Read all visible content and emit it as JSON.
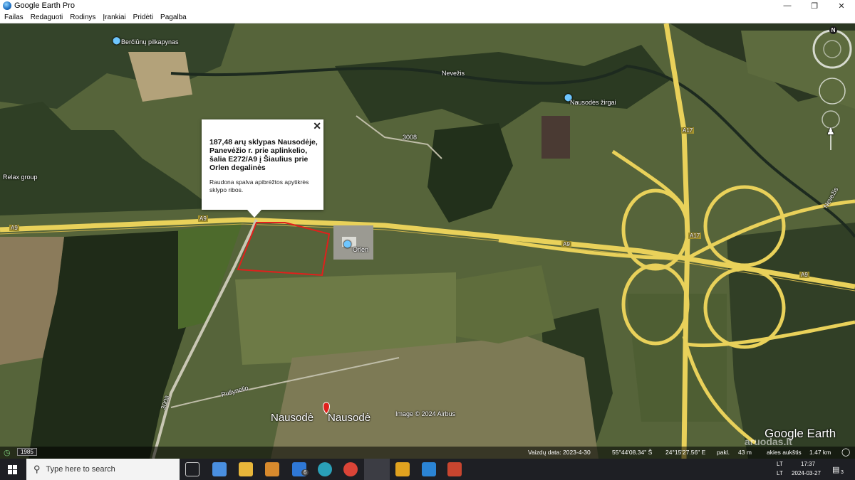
{
  "window": {
    "title": "Google Earth Pro",
    "minimize": "—",
    "maximize": "❐",
    "close": "✕"
  },
  "menu": [
    "Failas",
    "Redaguoti",
    "Rodinys",
    "Įrankiai",
    "Pridėti",
    "Pagalba"
  ],
  "map_labels": {
    "pilkapynas": "Berčiūnų pilkapynas",
    "nevezis_top": "Nevežis",
    "zirgai": "Nausodės žirgai",
    "relax": "Relax group",
    "road_3008": "3008",
    "a17_1": "A17",
    "a17_2": "A17",
    "a9_left": "A9",
    "a9_mid": "A9",
    "a9_junction": "A9",
    "a9_right": "A9",
    "nevezis_right": "Nevežis",
    "orlen": "Orlen",
    "pusynelio": "Pušynelio",
    "road_3008_bottom": "3008",
    "nausode_1": "Nausodė",
    "nausode_2": "Nausodė",
    "copyright": "Image © 2024 Airbus",
    "google_earth": "Google Earth",
    "north": "N"
  },
  "popup": {
    "title": "187,48 arų sklypas Nausodėje, Panevėžio r. prie aplinkelio, šalia E272/A9 į Šiaulius prie Orlen degalinės",
    "description": "Raudona spalva apibrėžtos apytikrės sklypo ribos.",
    "close": "✕"
  },
  "statusbar": {
    "year": "1985",
    "imagery_date": "Vaizdų data: 2023-4-30",
    "lat": "55°44'08.34\" Š",
    "lon": "24°15'27.56\" E",
    "elev": "pakl.",
    "elev_value": "43 m",
    "eye_alt": "akies aukštis",
    "eye_alt_value": "1.47 km"
  },
  "taskbar": {
    "search_placeholder": "Type here to search",
    "mail_badge": "6",
    "lang": "LT",
    "lang2": "LT",
    "time": "17:37",
    "date": "2024-03-27",
    "notif": "3"
  },
  "watermark": "aruodas.lt",
  "colors": {
    "highway": "#e9d15a",
    "boundary": "#e0201c",
    "farmland": "#6f7a45",
    "forest": "#26331d"
  }
}
